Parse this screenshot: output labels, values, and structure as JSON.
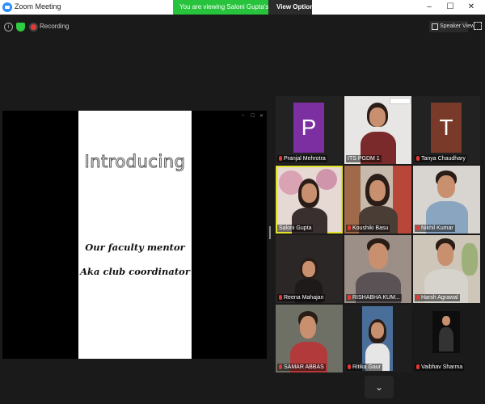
{
  "window": {
    "title": "Zoom Meeting",
    "share_banner": "You are viewing Saloni Gupta's screen",
    "view_options_label": "View Options",
    "view_options_chevron": "⌄",
    "minimize": "–",
    "maximize": "☐",
    "close": "✕"
  },
  "toolbar": {
    "info_glyph": "i",
    "recording_label": "Recording",
    "speaker_view_label": "Speaker View"
  },
  "share": {
    "ctl_min": "–",
    "ctl_max": "☐",
    "ctl_close": "✕"
  },
  "slide": {
    "title": "Introducing",
    "line1": "Our faculty mentor",
    "line2": "Aka club coordinator"
  },
  "participants": [
    {
      "name": "Pranjal Mehrotra",
      "avatar_letter": "P",
      "avatar_color": "#7b2fa0",
      "muted": true
    },
    {
      "name": "ITS PGDM 1",
      "muted": false
    },
    {
      "name": "Tanya Chaudhary",
      "avatar_letter": "T",
      "avatar_color": "#7a3a2a",
      "muted": true
    },
    {
      "name": "Saloni Gupta",
      "muted": false,
      "active_speaker": true
    },
    {
      "name": "Koushiki Basu",
      "muted": true
    },
    {
      "name": "Nikhil Kumar",
      "muted": true
    },
    {
      "name": "Reena Mahajan",
      "muted": true
    },
    {
      "name": "RISHABHA KUM...",
      "muted": true
    },
    {
      "name": "Harsh Agrawal",
      "muted": true
    },
    {
      "name": "SAMAR ABBAS",
      "muted": true
    },
    {
      "name": "Ritika Gaur",
      "muted": true
    },
    {
      "name": "Vaibhav Sharma",
      "muted": true
    }
  ],
  "gallery": {
    "page_down_glyph": "⌄"
  },
  "colors": {
    "banner_green": "#27c33c",
    "active_speaker_border": "#e2e22a",
    "recording_red": "#e53935"
  }
}
